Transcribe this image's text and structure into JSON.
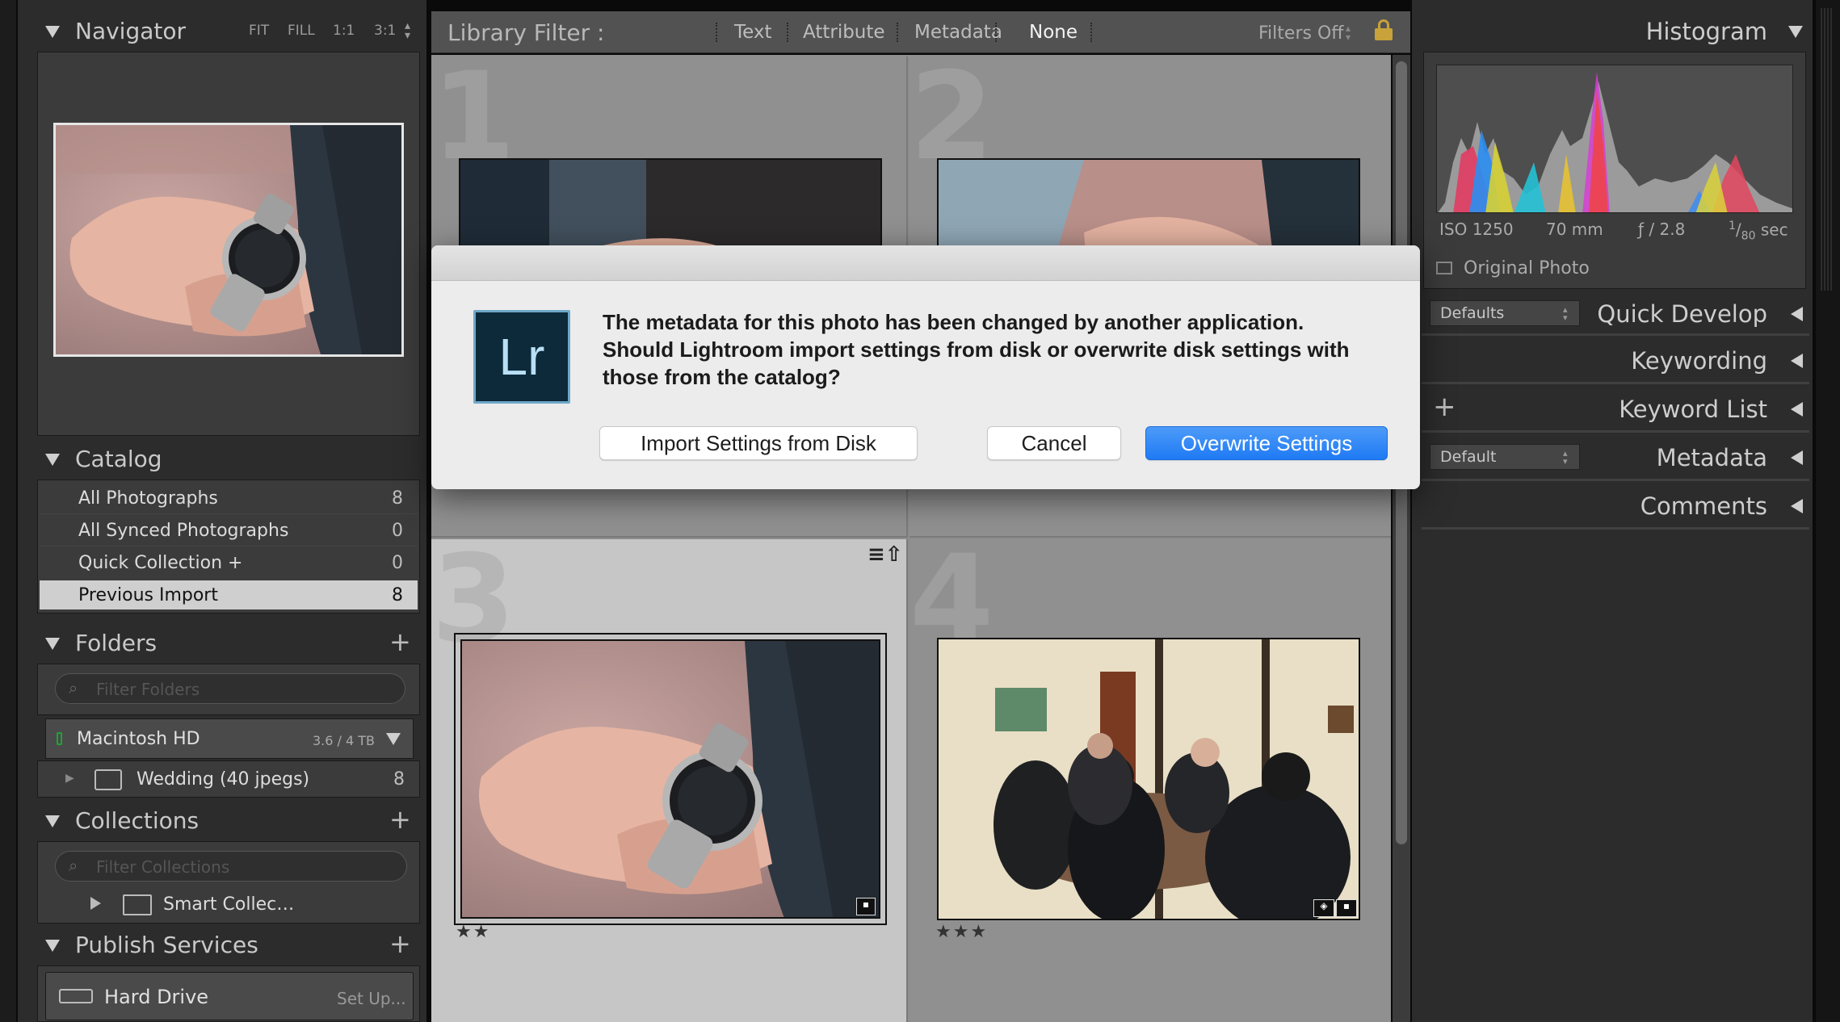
{
  "navigator": {
    "title": "Navigator",
    "zoom_options": [
      "FIT",
      "FILL",
      "1:1",
      "3:1"
    ]
  },
  "catalog": {
    "title": "Catalog",
    "items": [
      {
        "label": "All Photographs",
        "count": "8"
      },
      {
        "label": "All Synced Photographs",
        "count": "0"
      },
      {
        "label": "Quick Collection +",
        "count": "0"
      },
      {
        "label": "Previous Import",
        "count": "8"
      }
    ]
  },
  "folders": {
    "title": "Folders",
    "filter_placeholder": "Filter Folders",
    "volume": {
      "name": "Macintosh HD",
      "size": "3.6 / 4 TB"
    },
    "folder": {
      "name": "Wedding (40 jpegs)",
      "count": "8"
    }
  },
  "collections": {
    "title": "Collections",
    "filter_placeholder": "Filter Collections",
    "item": "Smart Collec…"
  },
  "publish": {
    "title": "Publish Services",
    "service": "Hard Drive",
    "setup": "Set Up..."
  },
  "filter_bar": {
    "title": "Library Filter :",
    "tabs": [
      "Text",
      "Attribute",
      "Metadata",
      "None"
    ],
    "active_tab": "None",
    "filters_status": "Filters Off"
  },
  "grid": {
    "cells": [
      {
        "number": "1",
        "stars": ""
      },
      {
        "number": "2",
        "stars": ""
      },
      {
        "number": "3",
        "stars": "★★"
      },
      {
        "number": "4",
        "stars": "★★★"
      }
    ]
  },
  "histogram": {
    "title": "Histogram",
    "iso": "ISO 1250",
    "focal": "70 mm",
    "aperture": "ƒ / 2.8",
    "shutter_num": "1",
    "shutter_den": "80",
    "shutter_unit": "sec",
    "original_photo": "Original Photo"
  },
  "right_panels": {
    "quick_develop": {
      "title": "Quick Develop",
      "preset": "Defaults"
    },
    "keywording": {
      "title": "Keywording"
    },
    "keyword_list": {
      "title": "Keyword List"
    },
    "metadata": {
      "title": "Metadata",
      "preset": "Default"
    },
    "comments": {
      "title": "Comments"
    }
  },
  "dialog": {
    "app_icon_text": "Lr",
    "message": "The metadata for this photo has been changed by another application. Should Lightroom import settings from disk or overwrite disk settings with those from the catalog?",
    "buttons": {
      "import": "Import Settings from Disk",
      "cancel": "Cancel",
      "overwrite": "Overwrite Settings"
    }
  },
  "colors": {
    "accent": "#2f86f6",
    "panel_bg": "#3b3b3b",
    "grid_bg": "#8e8e8e",
    "selected_cell": "#c6c6c6",
    "dialog_bg": "#ececec",
    "lr_icon_bg": "#0d2a3a",
    "lr_icon_fg": "#b9dff5"
  }
}
